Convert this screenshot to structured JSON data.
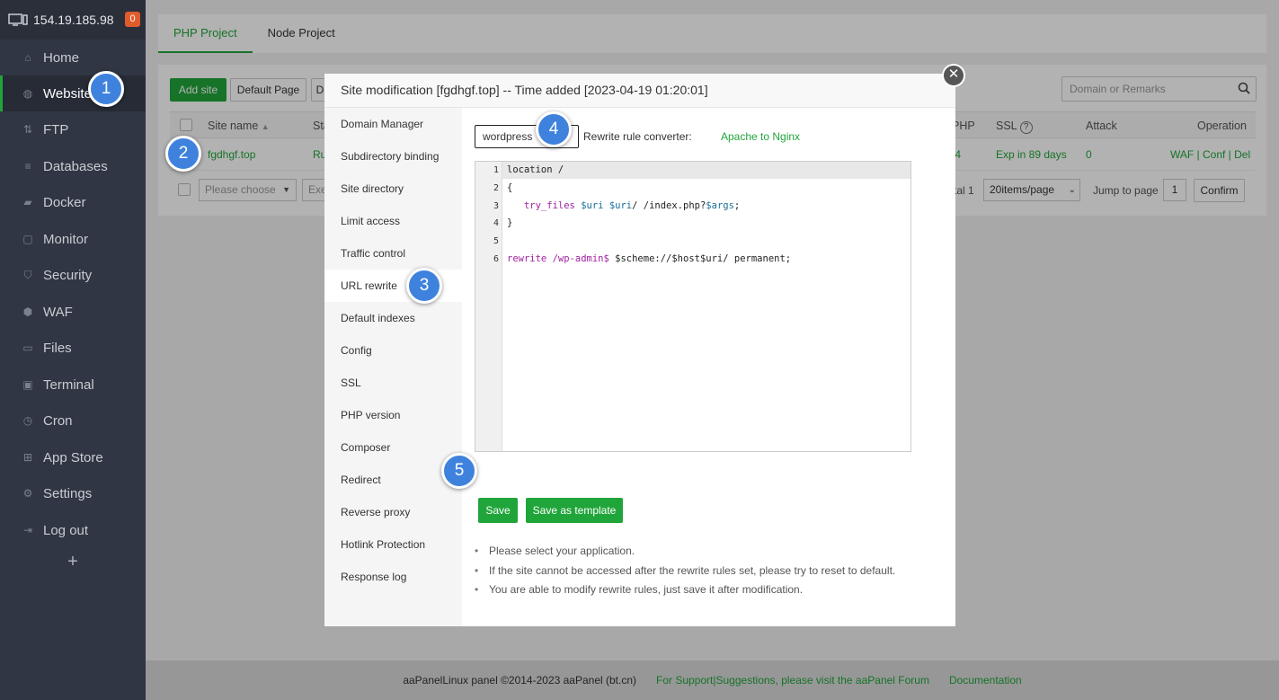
{
  "sidebar": {
    "ip": "154.19.185.98",
    "badge": "0",
    "items": [
      {
        "label": "Home",
        "icon": "home-icon"
      },
      {
        "label": "Website",
        "icon": "globe-icon"
      },
      {
        "label": "FTP",
        "icon": "ftp-icon"
      },
      {
        "label": "Databases",
        "icon": "database-icon"
      },
      {
        "label": "Docker",
        "icon": "docker-icon"
      },
      {
        "label": "Monitor",
        "icon": "monitor-icon"
      },
      {
        "label": "Security",
        "icon": "shield-icon"
      },
      {
        "label": "WAF",
        "icon": "waf-icon"
      },
      {
        "label": "Files",
        "icon": "folder-icon"
      },
      {
        "label": "Terminal",
        "icon": "terminal-icon"
      },
      {
        "label": "Cron",
        "icon": "clock-icon"
      },
      {
        "label": "App Store",
        "icon": "grid-icon"
      },
      {
        "label": "Settings",
        "icon": "gear-icon"
      },
      {
        "label": "Log out",
        "icon": "logout-icon"
      }
    ],
    "add": "+"
  },
  "tabs": [
    "PHP Project",
    "Node Project"
  ],
  "toolbar": {
    "add_site": "Add site",
    "default_page": "Default Page",
    "cut_btn": "D",
    "search_placeholder": "Domain or Remarks"
  },
  "table": {
    "headers": {
      "site_name": "Site name",
      "status": "Sta",
      "php": "PHP",
      "ssl": "SSL",
      "attack": "Attack",
      "operation": "Operation"
    },
    "row": {
      "site": "fgdhgf.top",
      "status": "Ru",
      "php": ".4",
      "ssl": "Exp in 89 days",
      "attack": "0",
      "ops": "WAF | Conf | Del"
    },
    "footer": {
      "choose": "Please choose",
      "exec": "Exe",
      "total": "tal 1",
      "per_page": "20items/page",
      "jump": "Jump to page",
      "page": "1",
      "confirm": "Confirm"
    }
  },
  "modal": {
    "title": "Site modification [fgdhgf.top] -- Time added [2023-04-19 01:20:01]",
    "menu": [
      "Domain Manager",
      "Subdirectory binding",
      "Site directory",
      "Limit access",
      "Traffic control",
      "URL rewrite",
      "Default indexes",
      "Config",
      "SSL",
      "PHP version",
      "Composer",
      "Redirect",
      "Reverse proxy",
      "Hotlink Protection",
      "Response log"
    ],
    "active_menu": "URL rewrite",
    "select_value": "wordpress",
    "converter_label": "Rewrite rule converter:",
    "converter_link": "Apache to Nginx",
    "line_numbers": [
      "1",
      "2",
      "3",
      "4",
      "5",
      "6"
    ],
    "code": {
      "l1": "location /",
      "l2": "{",
      "l3_a": "   try_files ",
      "l3_b": "$uri",
      "l3_c": " ",
      "l3_d": "$uri",
      "l3_e": "/ /index.php?",
      "l3_f": "$args",
      "l3_g": ";",
      "l4": "}",
      "l6_a": "rewrite",
      "l6_b": " /wp-admin$",
      "l6_c": " $scheme://$host$uri/ permanent;"
    },
    "save": "Save",
    "save_template": "Save as template",
    "tips": [
      "Please select your application.",
      "If the site cannot be accessed after the rewrite rules set, please try to reset to default.",
      "You are able to modify rewrite rules, just save it after modification."
    ],
    "close": "✕"
  },
  "markers": [
    "1",
    "2",
    "3",
    "4",
    "5"
  ],
  "footer": {
    "copyright": "aaPanelLinux panel ©2014-2023 aaPanel (bt.cn)",
    "support": "For Support|Suggestions, please visit the aaPanel Forum",
    "docs": "Documentation"
  },
  "colors": {
    "accent": "#20a53a",
    "sidebar": "#303643",
    "marker": "#3e82dd"
  }
}
